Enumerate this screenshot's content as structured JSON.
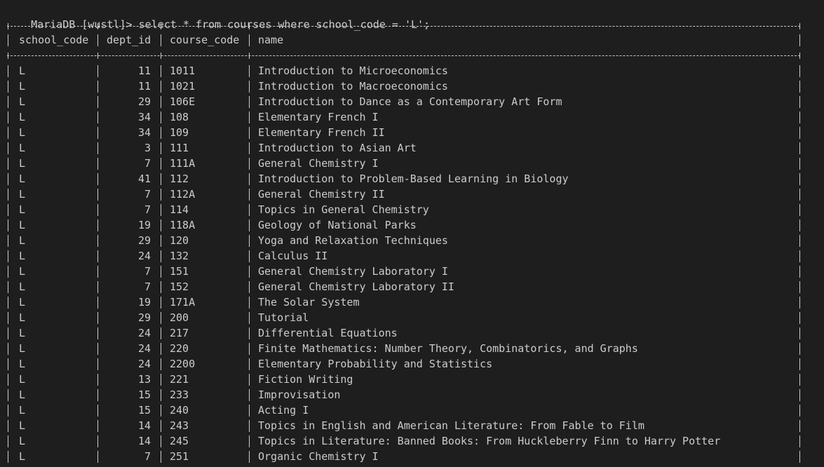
{
  "terminal": {
    "prompt": "MariaDB [wustl]> ",
    "command": "select * from courses where school_code = 'L';"
  },
  "table": {
    "headers": [
      "school_code",
      "dept_id",
      "course_code",
      "name"
    ],
    "rows": [
      [
        "L",
        "11",
        "1011",
        "Introduction to Microeconomics"
      ],
      [
        "L",
        "11",
        "1021",
        "Introduction to Macroeconomics"
      ],
      [
        "L",
        "29",
        "106E",
        "Introduction to Dance as a Contemporary Art Form"
      ],
      [
        "L",
        "34",
        "108",
        "Elementary French I"
      ],
      [
        "L",
        "34",
        "109",
        "Elementary French II"
      ],
      [
        "L",
        "3",
        "111",
        "Introduction to Asian Art"
      ],
      [
        "L",
        "7",
        "111A",
        "General Chemistry I"
      ],
      [
        "L",
        "41",
        "112",
        "Introduction to Problem-Based Learning in Biology"
      ],
      [
        "L",
        "7",
        "112A",
        "General Chemistry II"
      ],
      [
        "L",
        "7",
        "114",
        "Topics in General Chemistry"
      ],
      [
        "L",
        "19",
        "118A",
        "Geology of National Parks"
      ],
      [
        "L",
        "29",
        "120",
        "Yoga and Relaxation Techniques"
      ],
      [
        "L",
        "24",
        "132",
        "Calculus II"
      ],
      [
        "L",
        "7",
        "151",
        "General Chemistry Laboratory I"
      ],
      [
        "L",
        "7",
        "152",
        "General Chemistry Laboratory II"
      ],
      [
        "L",
        "19",
        "171A",
        "The Solar System"
      ],
      [
        "L",
        "29",
        "200",
        "Tutorial"
      ],
      [
        "L",
        "24",
        "217",
        "Differential Equations"
      ],
      [
        "L",
        "24",
        "220",
        "Finite Mathematics: Number Theory, Combinatorics, and Graphs"
      ],
      [
        "L",
        "24",
        "2200",
        "Elementary Probability and Statistics"
      ],
      [
        "L",
        "13",
        "221",
        "Fiction Writing"
      ],
      [
        "L",
        "15",
        "233",
        "Improvisation"
      ],
      [
        "L",
        "15",
        "240",
        "Acting I"
      ],
      [
        "L",
        "14",
        "243",
        "Topics in English and American Literature: From Fable to Film"
      ],
      [
        "L",
        "14",
        "245",
        "Topics in Literature: Banned Books: From Huckleberry Finn to Harry Potter"
      ],
      [
        "L",
        "7",
        "251",
        "Organic Chemistry I"
      ]
    ]
  }
}
